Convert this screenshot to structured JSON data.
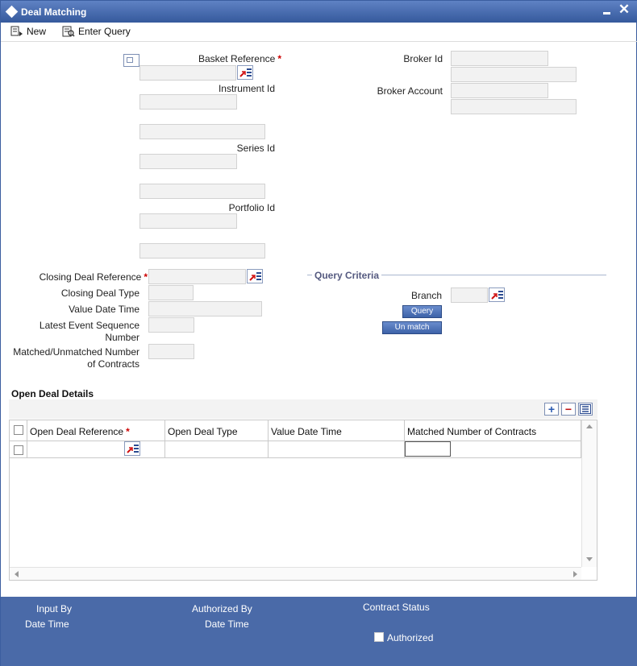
{
  "window": {
    "title": "Deal Matching"
  },
  "toolbar": {
    "new_label": "New",
    "enter_query_label": "Enter Query"
  },
  "form": {
    "basket_reference_label": "Basket Reference",
    "instrument_id_label": "Instrument Id",
    "series_id_label": "Series Id",
    "portfolio_id_label": "Portfolio Id",
    "broker_id_label": "Broker Id",
    "broker_account_label": "Broker Account",
    "closing_deal_reference_label": "Closing Deal Reference",
    "closing_deal_type_label": "Closing Deal Type",
    "value_date_time_label": "Value Date Time",
    "latest_event_sequence_label_1": "Latest Event Sequence",
    "latest_event_sequence_label_2": "Number",
    "matched_unmatched_label_1": "Matched/Unmatched Number",
    "matched_unmatched_label_2": "of Contracts",
    "required_marker": "*"
  },
  "query_criteria": {
    "title": "Query Criteria",
    "branch_label": "Branch",
    "query_button": "Query",
    "unmatch_button": "Un match"
  },
  "open_deal_details": {
    "title": "Open Deal Details",
    "columns": [
      "Open Deal Reference",
      "Open Deal Type",
      "Value Date Time",
      "Matched Number of Contracts"
    ],
    "add_symbol": "+",
    "remove_symbol": "−"
  },
  "footer": {
    "input_by_label": "Input By",
    "date_time_label_1": "Date Time",
    "authorized_by_label": "Authorized By",
    "date_time_label_2": "Date Time",
    "contract_status_label": "Contract Status",
    "authorized_label": "Authorized"
  },
  "colors": {
    "titlebar": "#3d62a8",
    "footer": "#4a6aa8",
    "required": "#cc0000",
    "field_bg": "#f2f2f2"
  },
  "icons": [
    "diamond-icon",
    "minimize-icon",
    "close-icon",
    "new-icon",
    "enter-query-icon",
    "list-of-values-icon",
    "add-row-icon",
    "delete-row-icon",
    "view-rows-icon"
  ]
}
